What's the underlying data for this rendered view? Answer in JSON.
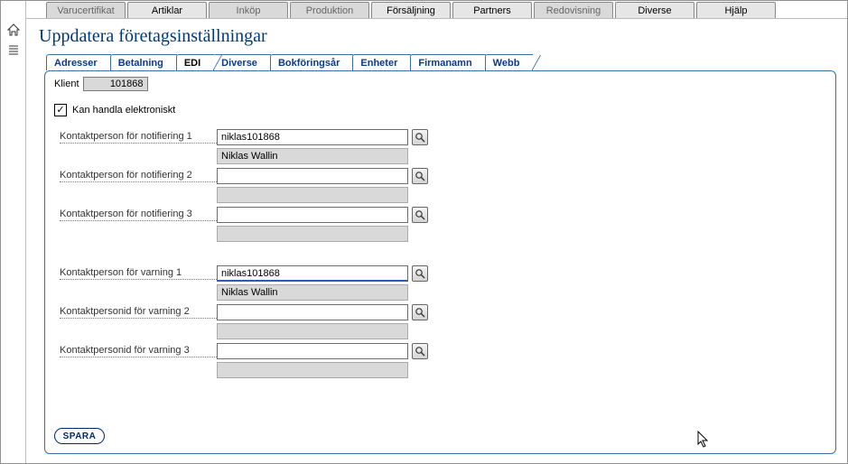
{
  "topmenu": [
    {
      "label": "Varucertifikat",
      "enabled": false
    },
    {
      "label": "Artiklar",
      "enabled": true
    },
    {
      "label": "Inköp",
      "enabled": false
    },
    {
      "label": "Produktion",
      "enabled": false
    },
    {
      "label": "Försäljning",
      "enabled": true
    },
    {
      "label": "Partners",
      "enabled": true
    },
    {
      "label": "Redovisning",
      "enabled": false
    },
    {
      "label": "Diverse",
      "enabled": true
    },
    {
      "label": "Hjälp",
      "enabled": true
    }
  ],
  "page_title": "Uppdatera företagsinställningar",
  "subtabs": [
    "Adresser",
    "Betalning",
    "EDI",
    "Diverse",
    "Bokföringsår",
    "Enheter",
    "Firmanamn",
    "Webb"
  ],
  "active_subtab": "EDI",
  "klient_label": "Klient",
  "klient_value": "101868",
  "checkbox": {
    "checked": true,
    "label": "Kan handla elektroniskt"
  },
  "group1": [
    {
      "label": "Kontaktperson för notifiering 1",
      "input": "niklas101868",
      "readout": "Niklas Wallin"
    },
    {
      "label": "Kontaktperson för notifiering 2",
      "input": "",
      "readout": ""
    },
    {
      "label": "Kontaktperson för notifiering 3",
      "input": "",
      "readout": ""
    }
  ],
  "group2": [
    {
      "label": "Kontaktperson för varning 1",
      "input": "niklas101868",
      "readout": "Niklas Wallin",
      "blueline": true
    },
    {
      "label": "Kontaktpersonid för varning 2",
      "input": "",
      "readout": ""
    },
    {
      "label": "Kontaktpersonid för varning 3",
      "input": "",
      "readout": ""
    }
  ],
  "save_label": "SPARA"
}
